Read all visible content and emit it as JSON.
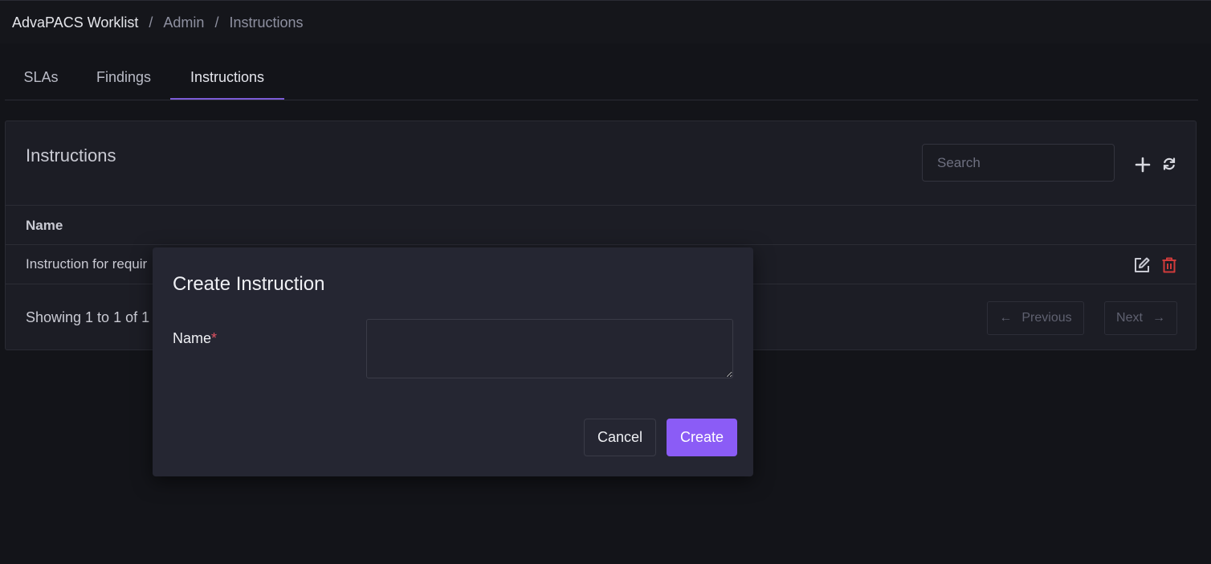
{
  "breadcrumb": {
    "root": "AdvaPACS Worklist",
    "items": [
      "Admin",
      "Instructions"
    ],
    "separator": "/"
  },
  "tabs": [
    {
      "label": "SLAs",
      "active": false
    },
    {
      "label": "Findings",
      "active": false
    },
    {
      "label": "Instructions",
      "active": true
    }
  ],
  "card": {
    "title": "Instructions",
    "search_placeholder": "Search",
    "add_icon": "plus-icon",
    "refresh_icon": "refresh-icon",
    "column_header": "Name",
    "rows": [
      {
        "name": "Instruction for requir",
        "edit_icon": "edit-icon",
        "delete_icon": "trash-icon"
      }
    ],
    "showing_text": "Showing 1 to 1 of 1",
    "previous_label": "Previous",
    "next_label": "Next"
  },
  "modal": {
    "title": "Create Instruction",
    "field_label": "Name",
    "required_marker": "*",
    "name_value": "",
    "cancel_label": "Cancel",
    "create_label": "Create"
  },
  "colors": {
    "accent": "#8b5cf6",
    "danger": "#d03b3b",
    "tab_indicator": "#7b5cd6"
  }
}
